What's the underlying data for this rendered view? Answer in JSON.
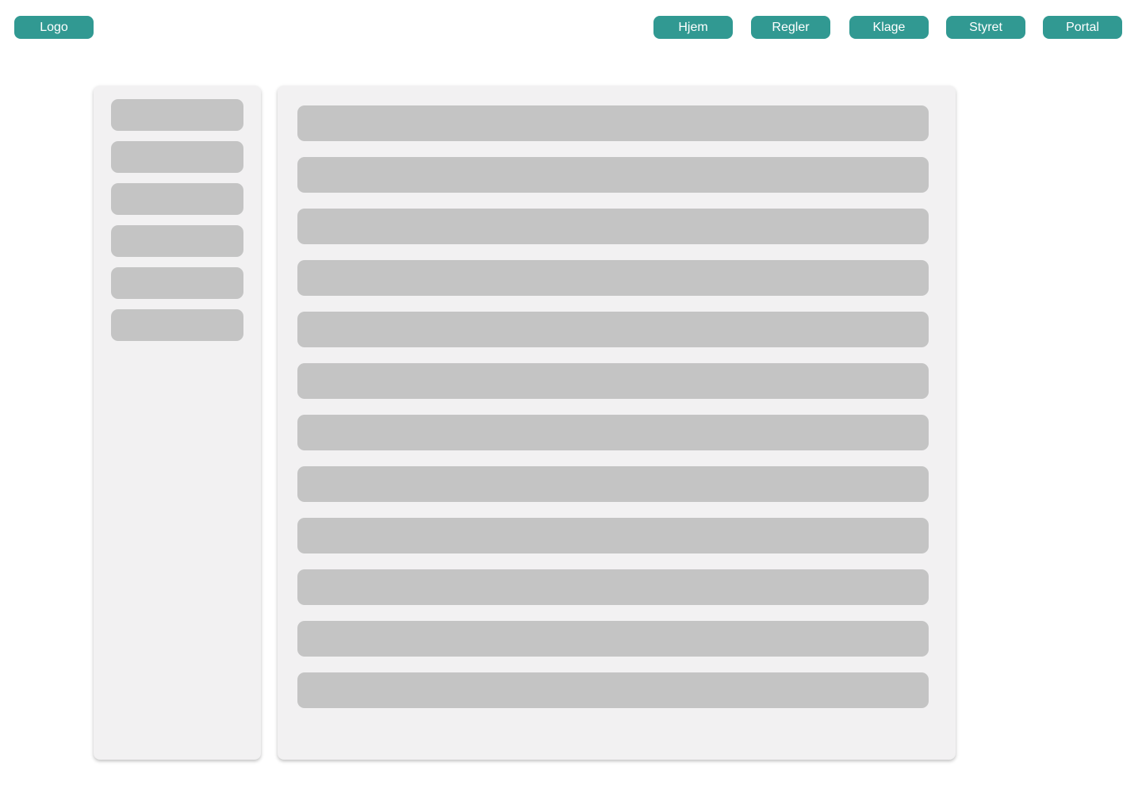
{
  "header": {
    "logo_label": "Logo",
    "nav_items": [
      {
        "key": "hjem",
        "label": "Hjem"
      },
      {
        "key": "regler",
        "label": "Regler"
      },
      {
        "key": "klage",
        "label": "Klage"
      },
      {
        "key": "styret",
        "label": "Styret"
      },
      {
        "key": "portal",
        "label": "Portal"
      }
    ]
  },
  "sidebar": {
    "placeholder_item_count": 6
  },
  "content": {
    "placeholder_row_count": 12
  },
  "colors": {
    "accent": "#319992",
    "button_text": "#ffffff",
    "panel_background": "#f2f1f2",
    "placeholder": "#c4c4c4",
    "page_background": "#ffffff"
  }
}
